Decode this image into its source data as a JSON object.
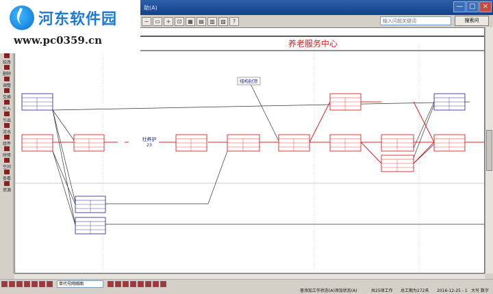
{
  "watermark": {
    "name": "河东软件园",
    "url": "www.pc0359.cn"
  },
  "window": {
    "title_fragment": "助(A)",
    "minimize_glyph": "—",
    "maximize_glyph": "□",
    "close_glyph": "×"
  },
  "toolbar": {
    "help_glyph": "?",
    "search_placeholder": "输入问题关键词",
    "search_button": "搜索问"
  },
  "sidebar": {
    "items": [
      {
        "label": "绘改",
        "icon": "pencil-icon"
      },
      {
        "label": "删除",
        "icon": "delete-icon"
      },
      {
        "label": "调整",
        "icon": "adjust-icon"
      },
      {
        "label": "交换",
        "icon": "swap-icon"
      },
      {
        "label": "引入",
        "icon": "import-icon"
      },
      {
        "label": "引出",
        "icon": "export-icon"
      },
      {
        "label": "流水",
        "icon": "flow-icon"
      },
      {
        "label": "组件",
        "icon": "component-icon"
      },
      {
        "label": "时修",
        "icon": "clock-icon"
      },
      {
        "label": "空间",
        "icon": "space-icon"
      },
      {
        "label": "查看",
        "icon": "view-icon"
      },
      {
        "label": "资源",
        "icon": "resource-icon"
      }
    ]
  },
  "diagram": {
    "title": "养老服务中心",
    "annotation": "结构封顶",
    "milestone_label": "社养护",
    "milestone_value": "23"
  },
  "bottombar": {
    "view_select": "单代号网络图"
  },
  "status": {
    "mode": "普添加工作状态(A)添加状态(A)",
    "count": "共25项工作",
    "duration": "总工期为272天",
    "date": "2016-12-25 - 1",
    "keys": "大写 数字"
  },
  "colors": {
    "critical": "#e02020",
    "normal": "#1a1a9a",
    "title_red": "#d42020"
  }
}
